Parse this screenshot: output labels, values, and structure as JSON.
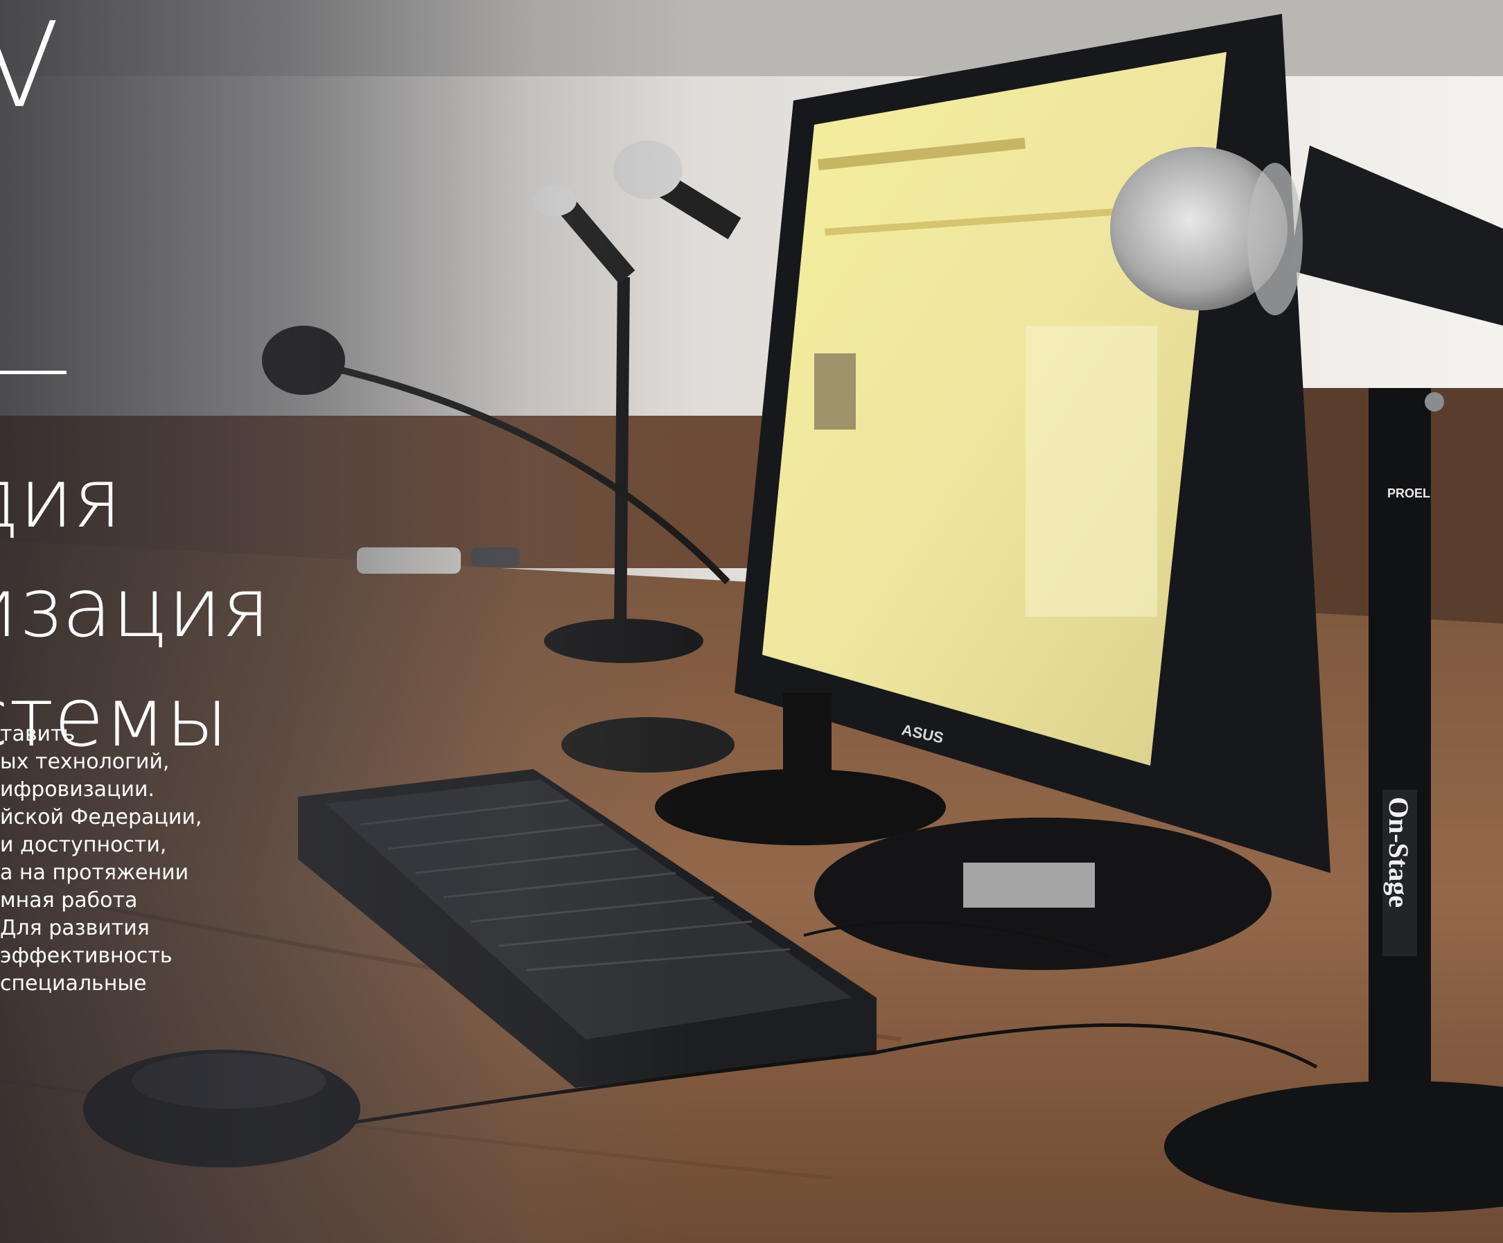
{
  "hero": {
    "big_letter": "V",
    "heading_lines": [
      "дия",
      "изация",
      "стемы"
    ],
    "body_lines": [
      "тавить",
      "ых технологий,",
      "ифровизации.",
      "йской Федерации,",
      "и доступности,",
      "а на протяжении",
      "мная работа",
      "Для развития",
      "эффективность",
      "специальные"
    ]
  },
  "photo": {
    "monitor_brand": "ASUS",
    "mic_brand": "PROEL",
    "stand_brand": "On-Stage"
  },
  "colors": {
    "overlay": "#3c3c42",
    "text": "#ffffff",
    "desk": "#8a5e3f"
  }
}
